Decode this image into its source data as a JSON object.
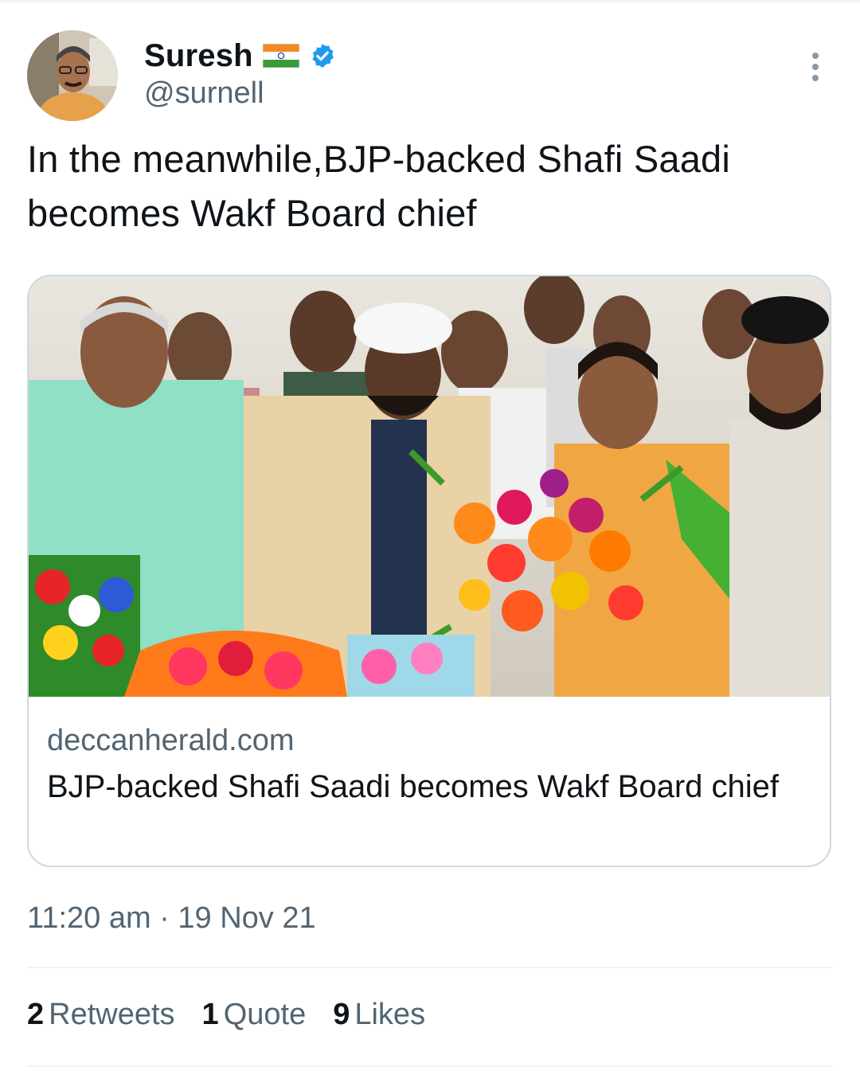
{
  "author": {
    "name": "Suresh",
    "handle": "@surnell",
    "flag_icon": "india-flag-icon",
    "verified_icon": "verified-badge-icon",
    "verified_color": "#1d9bf0"
  },
  "tweet": {
    "text": "In the meanwhile,BJP-backed Shafi Saadi becomes Wakf Board chief",
    "timestamp": "11:20 am · 19 Nov 21"
  },
  "link_card": {
    "domain": "deccanherald.com",
    "title": "BJP-backed Shafi Saadi becomes Wakf Board chief"
  },
  "stats": [
    {
      "count": "2",
      "label": "Retweets"
    },
    {
      "count": "1",
      "label": "Quote"
    },
    {
      "count": "9",
      "label": "Likes"
    }
  ],
  "icons": {
    "more": "more-options-icon"
  }
}
